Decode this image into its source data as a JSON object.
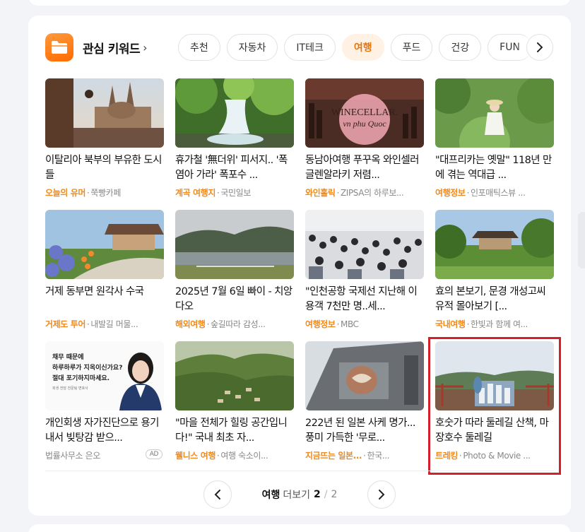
{
  "header": {
    "title": "관심 키워드",
    "chevron": "›"
  },
  "chips": [
    {
      "label": "추천",
      "active": false
    },
    {
      "label": "자동차",
      "active": false
    },
    {
      "label": "IT테크",
      "active": false
    },
    {
      "label": "여행",
      "active": true
    },
    {
      "label": "푸드",
      "active": false
    },
    {
      "label": "건강",
      "active": false
    },
    {
      "label": "FUN",
      "active": false
    }
  ],
  "items": [
    {
      "title": "이탈리아 북부의 부유한 도시들",
      "tag": "오늘의 유머",
      "source": "쭉빵카페",
      "thumb": "cathedral",
      "ad": ""
    },
    {
      "title": "휴가철 '無더위' 피서지.. '폭염아 가라' 폭포수 ...",
      "tag": "계곡 여행지",
      "source": "국민일보",
      "thumb": "waterfall",
      "ad": ""
    },
    {
      "title": "동남아여행 푸꾸옥 와인셀러 글렌알라키 저렴...",
      "tag": "와인홀릭",
      "source": "ZIPSA의 하루보...",
      "thumb": "wine",
      "ad": ""
    },
    {
      "title": "\"대프리카는 옛말\" 118년 만에 겪는 역대급 ...",
      "tag": "여행정보",
      "source": "인포매틱스뷰 ...",
      "thumb": "garden",
      "ad": ""
    },
    {
      "title": "거제 동부면 원각사 수국",
      "tag": "거제도 투어",
      "source": "내발길 머물...",
      "thumb": "temple",
      "ad": ""
    },
    {
      "title": "2025년 7월 6일 빠이 - 치앙다오",
      "tag": "해외여행",
      "source": "숲길따라 감성...",
      "thumb": "lake",
      "ad": ""
    },
    {
      "title": "\"인천공항 국제선 지난해 이용객 7천만 명..세...",
      "tag": "여행정보",
      "source": "MBC",
      "thumb": "crowd",
      "ad": ""
    },
    {
      "title": "효의 본보기, 문경 개성고씨 유적 몰아보기 [...",
      "tag": "국내여행",
      "source": "한빛과 함께 여...",
      "thumb": "pavilion",
      "ad": ""
    },
    {
      "title": "개인회생 자가진단으로 용기내서 빚탕감 받으...",
      "tag": "",
      "source": "법률사무소 은오",
      "thumb": "ad-woman",
      "ad": "AD",
      "ad_line1": "채무 때문에",
      "ad_line2": "하루하루가 지옥이신가요?",
      "ad_line3": "절대 포기하지마세요.",
      "ad_small": "회생 전담 전문팀 변호사"
    },
    {
      "title": "\"마을 전체가 힐링 공간입니다!\" 국내 최초 자...",
      "tag": "웰니스 여행",
      "source": "여행 숙소이...",
      "thumb": "mountain",
      "ad": ""
    },
    {
      "title": "222년 된 일본 사케 명가... 풍미 가득한 '무로...",
      "tag": "지금뜨는 일본...",
      "source": "한국...",
      "thumb": "sake",
      "ad": ""
    },
    {
      "title": "호숫가 따라 둘레길 산책, 마장호수 둘레길",
      "tag": "트레킹",
      "source": "Photo & Movie ...",
      "thumb": "lakeside",
      "ad": ""
    }
  ],
  "wine_sign": {
    "line1": "WINECELLAR.",
    "line2": "vn phu Quoc"
  },
  "pager": {
    "keyword": "여행",
    "more": "더보기",
    "current": "2",
    "total": "2"
  }
}
